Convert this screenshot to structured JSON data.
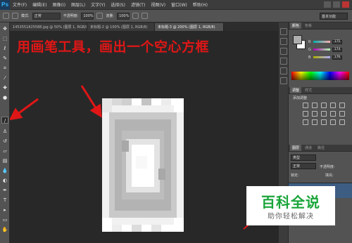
{
  "app": {
    "logo": "Ps"
  },
  "menu": [
    "文件(F)",
    "编辑(E)",
    "图像(I)",
    "图层(L)",
    "文字(Y)",
    "选择(S)",
    "滤镜(T)",
    "视图(V)",
    "窗口(W)",
    "帮助(H)"
  ],
  "options": {
    "mode_label": "模式:",
    "mode_value": "正常",
    "opacity_label": "不透明度:",
    "opacity_value": "100%",
    "flow_label": "流量:",
    "flow_value": "100%",
    "workspace": "基本功能"
  },
  "tabs": [
    {
      "label": "1453551825588.jpg @ 50% (图层 1, RGB/8)",
      "active": false
    },
    {
      "label": "未标题-2 @ 100% (图层 1, RGB/8)",
      "active": false
    },
    {
      "label": "未标题-3 @ 200% (图层 1, RGB/8)",
      "active": true
    }
  ],
  "annotation": "用画笔工具，画出一个空心方框",
  "color_panel": {
    "tabs": [
      "颜色",
      "色板"
    ],
    "r": "175",
    "g": "174",
    "b": "176"
  },
  "adjustments_panel": {
    "tabs": [
      "调整",
      "样式"
    ],
    "title": "添加调整"
  },
  "layers_panel": {
    "tabs": [
      "图层",
      "通道",
      "路径"
    ],
    "kind_label": "类型",
    "blend_mode": "正常",
    "opacity_label": "不透明度:",
    "lock_label": "锁定:",
    "fill_label": "填充:"
  },
  "watermark": {
    "title": "百科全说",
    "subtitle": "助你轻松解决"
  }
}
